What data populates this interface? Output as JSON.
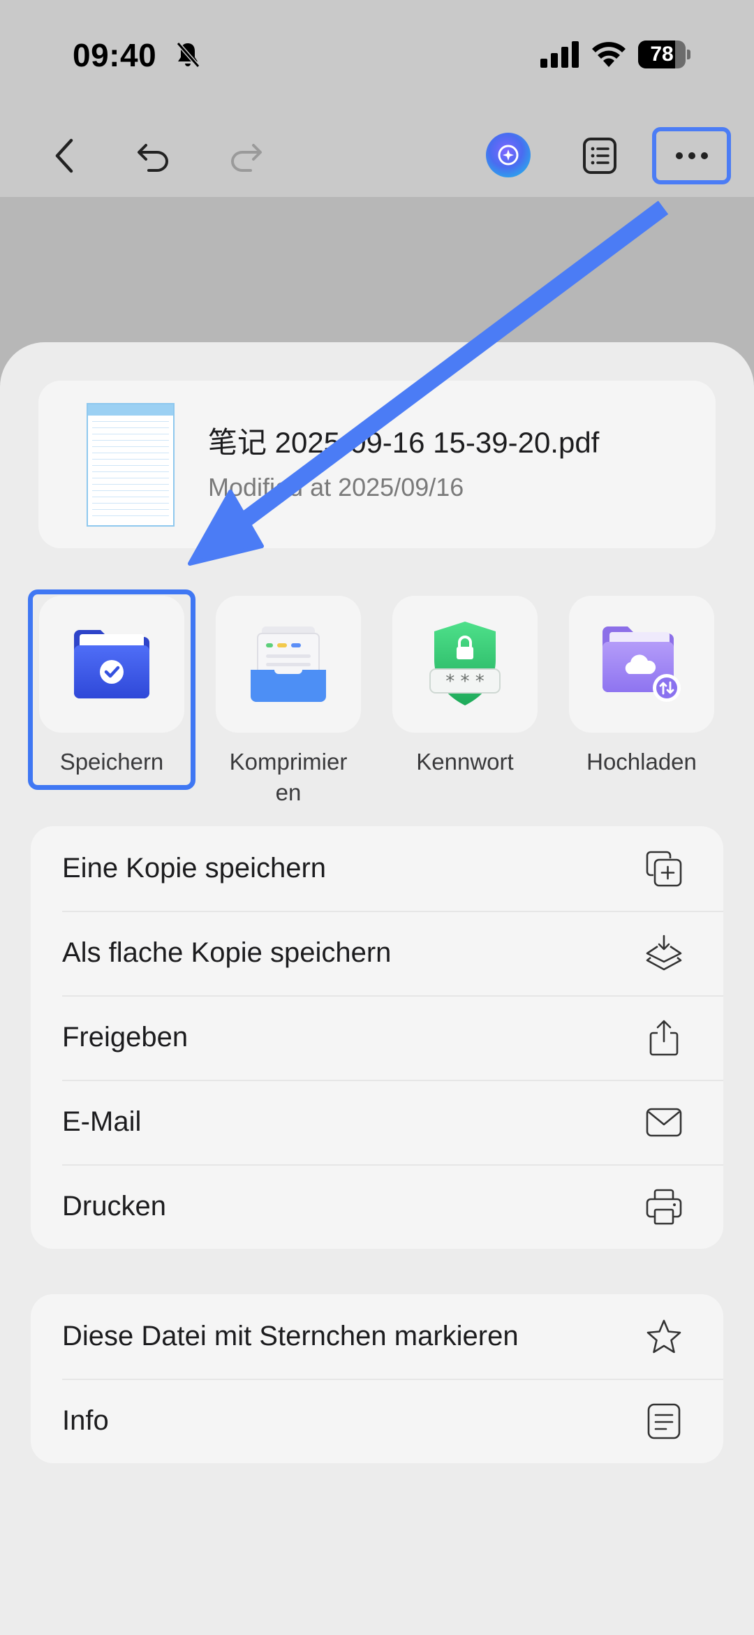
{
  "status_bar": {
    "time": "09:40",
    "battery": "78",
    "battery_level": 0.78
  },
  "toolbar": {
    "icons": [
      "back-icon",
      "undo-icon",
      "redo-icon",
      "ai-assistant-icon",
      "outline-icon",
      "more-icon"
    ]
  },
  "file": {
    "name": "笔记 2025-09-16 15-39-20.pdf",
    "modified": "Modified at 2025/09/16"
  },
  "quick_actions": [
    {
      "label": "Speichern",
      "icon": "save-folder-icon"
    },
    {
      "label": "Komprimier\nen",
      "icon": "compress-icon"
    },
    {
      "label": "Kennwort",
      "icon": "password-shield-icon"
    },
    {
      "label": "Hochladen",
      "icon": "upload-cloud-folder-icon"
    }
  ],
  "menu_group_1": [
    {
      "label": "Eine Kopie speichern",
      "icon": "copy-plus-icon"
    },
    {
      "label": "Als flache Kopie speichern",
      "icon": "flatten-layers-icon"
    },
    {
      "label": "Freigeben",
      "icon": "share-icon"
    },
    {
      "label": "E-Mail",
      "icon": "mail-icon"
    },
    {
      "label": "Drucken",
      "icon": "printer-icon"
    }
  ],
  "menu_group_2": [
    {
      "label": "Diese Datei mit Sternchen markieren",
      "icon": "star-icon"
    },
    {
      "label": "Info",
      "icon": "info-document-icon"
    }
  ],
  "colors": {
    "highlight": "#3f77f3",
    "sheet": "#ececec",
    "card": "#f5f5f5"
  }
}
